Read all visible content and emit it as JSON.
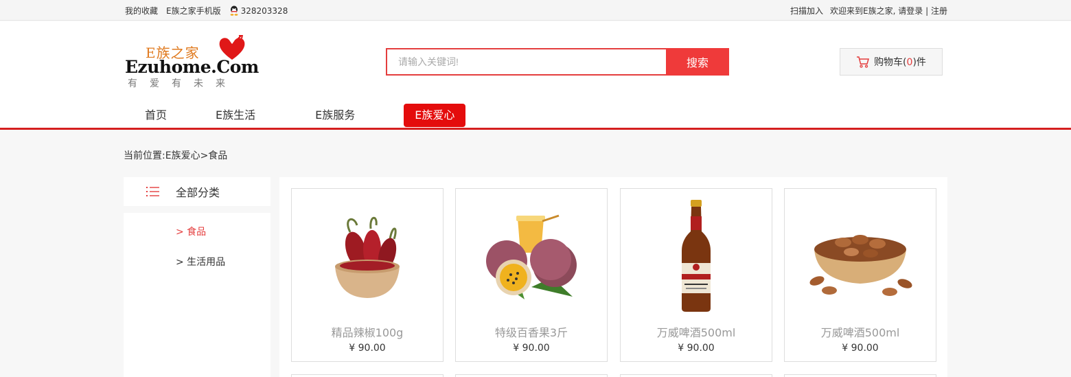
{
  "topbar": {
    "favorites": "我的收藏",
    "mobile": "E族之家手机版",
    "qq": "328203328",
    "scan": "扫描加入",
    "welcome": "欢迎来到E族之家,",
    "login": "请登录",
    "divider": "|",
    "register": "注册"
  },
  "logo": {
    "cn": "E族之家",
    "en": "Ezuhome.Com",
    "slogan": "有爱有未来"
  },
  "search": {
    "placeholder": "请输入关键词!",
    "button": "搜索"
  },
  "cart": {
    "label": "购物车(",
    "count": "0",
    "suffix": ")件"
  },
  "nav": {
    "items": [
      "首页",
      "E族生活",
      "E族服务",
      "E族爱心"
    ],
    "active_index": 3
  },
  "breadcrumb": {
    "prefix": "当前位置:",
    "path": "E族爱心>食品"
  },
  "sidebar": {
    "title": "全部分类",
    "categories": [
      "> 食品",
      "> 生活用品"
    ],
    "active_index": 0
  },
  "products": [
    {
      "name": "精品辣椒100g",
      "price": "¥ 90.00",
      "image": "chili-peppers"
    },
    {
      "name": "特级百香果3斤",
      "price": "¥ 90.00",
      "image": "passion-fruit"
    },
    {
      "name": "万威啤酒500ml",
      "price": "¥ 90.00",
      "image": "beer-bottle"
    },
    {
      "name": "万威啤酒500ml",
      "price": "¥ 90.00",
      "image": "pine-nuts"
    }
  ],
  "colors": {
    "accent": "#e43d3d",
    "nav_active": "#e40c0c",
    "nav_line": "#d51f1f"
  }
}
